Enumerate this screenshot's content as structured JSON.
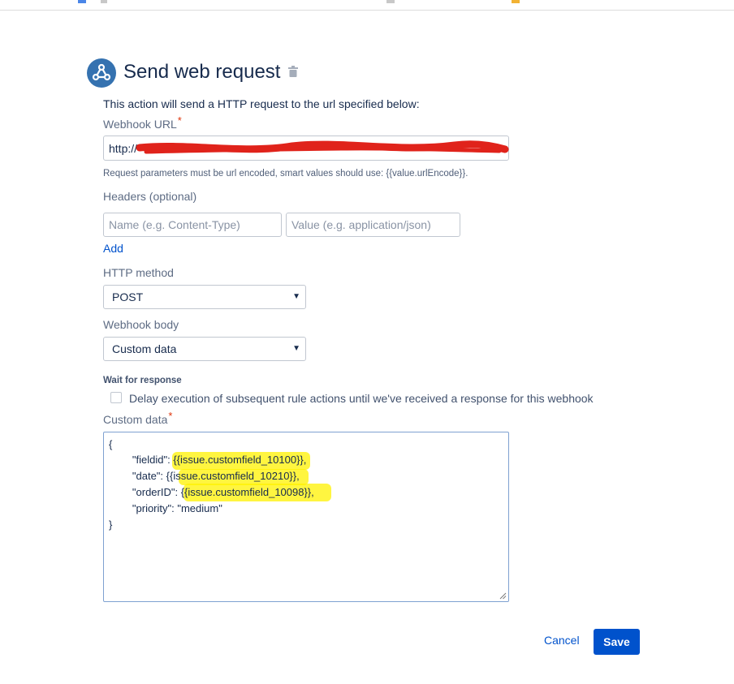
{
  "header": {
    "title": "Send web request",
    "icon": "webhook-icon",
    "delete_icon": "trash-icon"
  },
  "description": "This action will send a HTTP request to the url specified below:",
  "webhook_url": {
    "label": "Webhook URL",
    "required_mark": "*",
    "value": "http://",
    "help": "Request parameters must be url encoded, smart values should use: {{value.urlEncode}}."
  },
  "headers": {
    "label": "Headers (optional)",
    "name_placeholder": "Name (e.g. Content-Type)",
    "value_placeholder": "Value (e.g. application/json)",
    "add_label": "Add"
  },
  "http_method": {
    "label": "HTTP method",
    "selected": "POST"
  },
  "webhook_body": {
    "label": "Webhook body",
    "selected": "Custom data"
  },
  "wait_for_response": {
    "label": "Wait for response",
    "checkbox_label": "Delay execution of subsequent rule actions until we've received a response for this webhook",
    "checked": false
  },
  "custom_data": {
    "label": "Custom data",
    "required_mark": "*",
    "lines": [
      "{",
      "        \"fieldid\": {{issue.customfield_10100}},",
      "        \"date\": {{issue.customfield_10210}},",
      "        \"orderID\": {{issue.customfield_10098}},",
      "        \"priority\": \"medium\"",
      "}"
    ]
  },
  "actions": {
    "cancel_label": "Cancel",
    "save_label": "Save"
  },
  "colors": {
    "primary": "#0052cc",
    "icon_bg": "#3572b0",
    "highlight": "#fff200",
    "redaction": "#e0231b"
  }
}
